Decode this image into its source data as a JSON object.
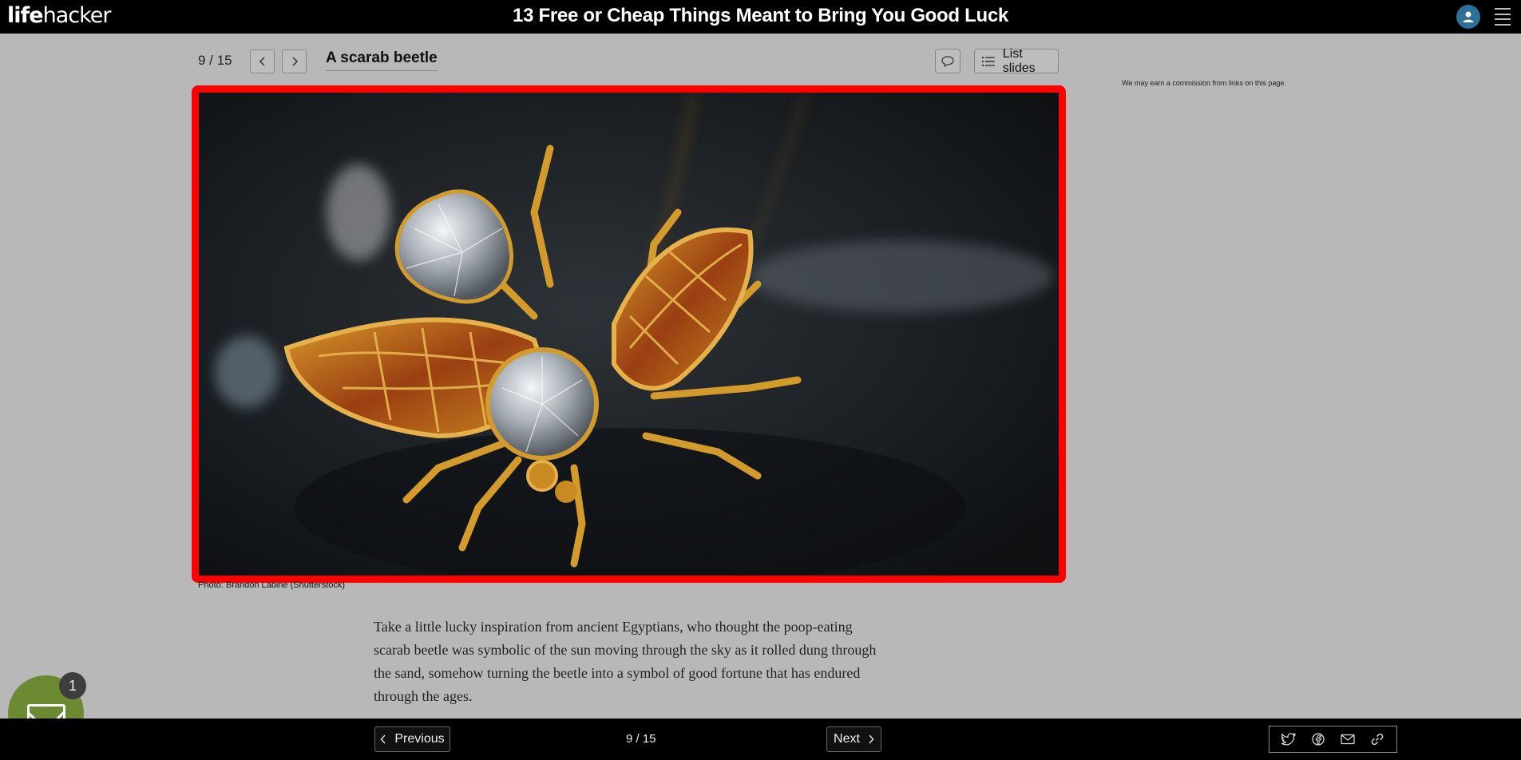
{
  "header": {
    "logo_bold": "life",
    "logo_light": "hacker",
    "title": "13 Free or Cheap Things Meant to Bring You Good Luck"
  },
  "slide": {
    "counter": "9 / 15",
    "heading": "A scarab beetle",
    "list_label": "List slides",
    "disclaimer": "We may earn a commission from links on this page.",
    "photo_credit": "Photo: Brandon Labine (Shutterstock)",
    "body": "Take a little lucky inspiration from ancient Egyptians, who thought the poop-eating scarab beetle was symbolic of the sun moving through the sky as it rolled dung through the sand, somehow turning the beetle into a symbol of good fortune that has endured through the ages."
  },
  "newsletter": {
    "badge_count": "1"
  },
  "footer": {
    "previous_label": "Previous",
    "next_label": "Next",
    "counter": "9 / 15"
  },
  "icons": [
    "user-icon",
    "hamburger-menu-icon",
    "chevron-left-icon",
    "chevron-right-icon",
    "comment-icon",
    "list-icon",
    "envelope-icon",
    "twitter-icon",
    "facebook-icon",
    "email-icon",
    "link-icon"
  ],
  "colors": {
    "highlight_border": "#ff0000",
    "bar_background": "#000000",
    "avatar": "#2e6f97",
    "newsletter": "#6b8a32"
  }
}
